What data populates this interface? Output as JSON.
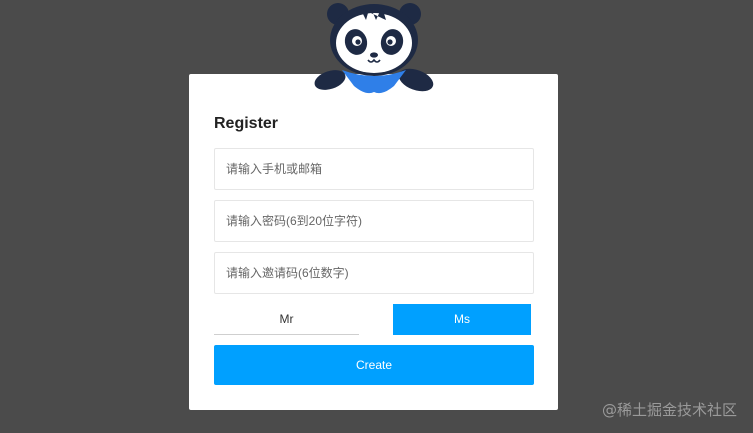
{
  "form": {
    "title": "Register",
    "phone_or_email_placeholder": "请输入手机或邮箱",
    "password_placeholder": "请输入密码(6到20位字符)",
    "invite_code_placeholder": "请输入邀请码(6位数字)",
    "gender_options": [
      "Mr",
      "Ms"
    ],
    "selected_gender": "Ms",
    "create_label": "Create"
  },
  "watermark": "@稀土掘金技术社区",
  "colors": {
    "background": "#4b4b4b",
    "card": "#ffffff",
    "accent": "#00a0ff",
    "panda_dark": "#1e2a44",
    "scarf": "#2f7fe8"
  },
  "icons": {
    "mascot": "panda-mascot-icon"
  }
}
